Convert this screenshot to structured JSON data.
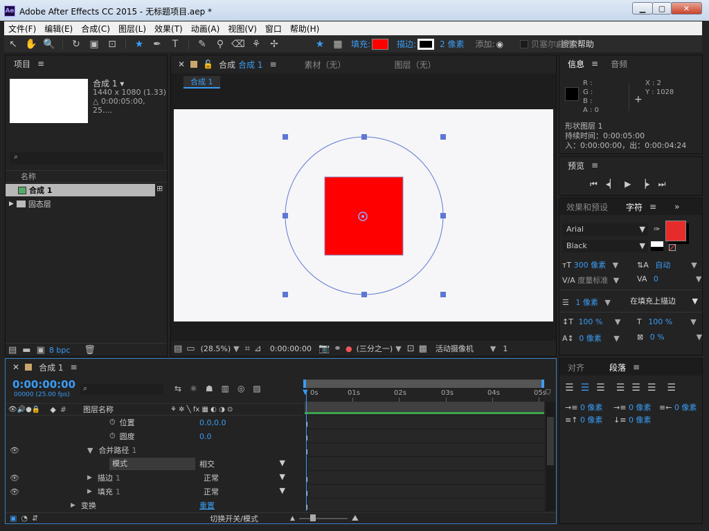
{
  "window": {
    "title": "Adobe After Effects CC 2015 - 无标题项目.aep *",
    "logo": "Ae"
  },
  "menu": [
    "文件(F)",
    "编辑(E)",
    "合成(C)",
    "图层(L)",
    "效果(T)",
    "动画(A)",
    "视图(V)",
    "窗口",
    "帮助(H)"
  ],
  "toolbar": {
    "fill_label": "填充:",
    "fill_color": "#ff0000",
    "stroke_label": "描边:",
    "stroke_width": "2 像素",
    "add_label": "添加:",
    "search_help": "搜索帮助",
    "overlap_text": "贝塞尔曲线"
  },
  "project": {
    "title": "项目",
    "comp_name": "合成 1 ▾",
    "comp_size": "1440 x 1080 (1.33)",
    "comp_duration": "△ 0:00:05:00, 25....",
    "col_name": "名称",
    "items": [
      {
        "name": "合成 1"
      },
      {
        "name": "固态层"
      }
    ],
    "bpc": "8 bpc"
  },
  "viewer": {
    "tab_comp": "合成",
    "tab_comp_name": "合成 1",
    "tab_footage": "素材（无）",
    "tab_layer": "图层（无）",
    "breadcrumb": "合成 1",
    "zoom": "(28.5%)",
    "timecode": "0:00:00:00",
    "resolution": "(三分之一)",
    "camera": "活动摄像机",
    "views": "1"
  },
  "info": {
    "tab_info": "信息",
    "tab_audio": "音频",
    "r": "R :",
    "g": "G :",
    "b": "B :",
    "a": "A : 0",
    "x": "X : 2",
    "y": "Y : 1028",
    "layer": "形状图层 1",
    "duration": "持续时间：0:00:05:00",
    "inout": "入：0:00:00:00，出：0:00:04:24"
  },
  "preview": {
    "title": "预览"
  },
  "character": {
    "tab_effects": "效果和预设",
    "tab_char": "字符",
    "font": "Arial",
    "style": "Black",
    "size": "300 像素",
    "leading": "自动",
    "kerning": "度量标准",
    "tracking": "0",
    "stroke_w": "1 像素",
    "stroke_mode": "在填充上描边",
    "vscale": "100 %",
    "hscale": "100 %",
    "baseline": "0 像素",
    "tsume": "0 %",
    "fill_color": "#e62b2b"
  },
  "paragraph": {
    "tab_align": "对齐",
    "tab_para": "段落",
    "indent_left": "0 像素",
    "indent_first": "0 像素",
    "indent_right": "0 像素",
    "space_before": "0 像素",
    "space_after": "0 像素"
  },
  "timeline": {
    "title": "合成 1",
    "timecode": "0:00:00:00",
    "frames": "00000 (25.00 fps)",
    "col_layer": "图层名称",
    "col_hash": "#",
    "ruler": [
      "0s",
      "01s",
      "02s",
      "03s",
      "04s",
      "05s"
    ],
    "rows": [
      {
        "name": "位置",
        "value": "0.0,0.0"
      },
      {
        "name": "圆度",
        "value": "0.0"
      },
      {
        "name": "合并路径",
        "idx": "1"
      },
      {
        "name": "模式",
        "value": "相交"
      },
      {
        "name": "描边",
        "idx": "1",
        "value": "正常"
      },
      {
        "name": "填充",
        "idx": "1",
        "value": "正常"
      },
      {
        "name": "变换",
        "value": "重置"
      }
    ],
    "toggle_label": "切换开关/模式"
  }
}
